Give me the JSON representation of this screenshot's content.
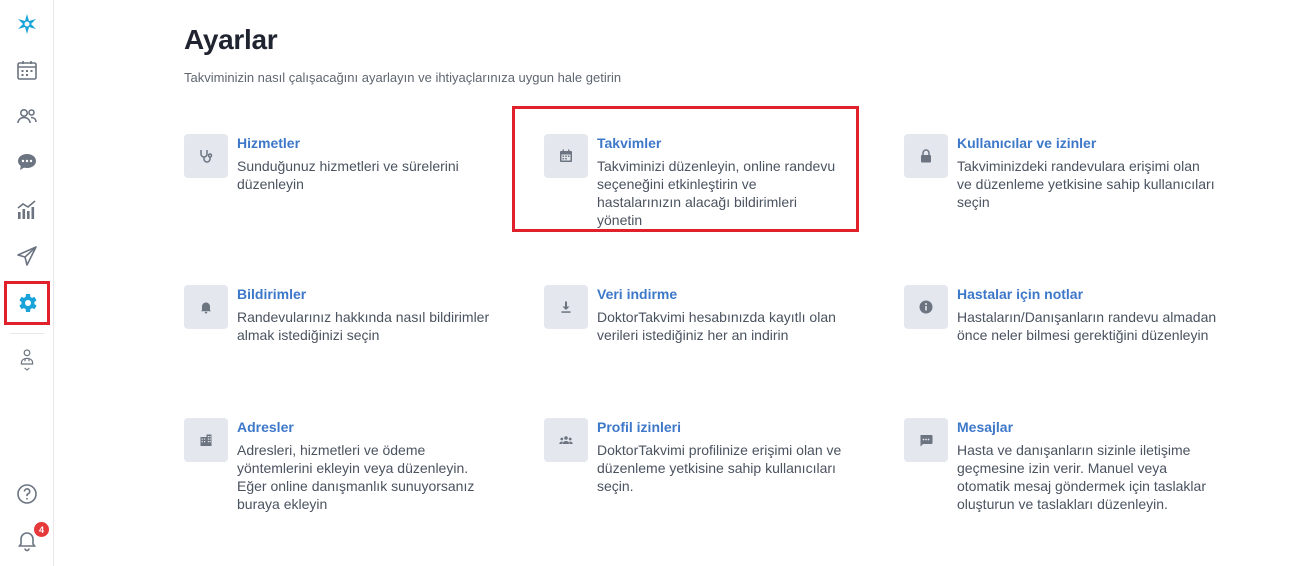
{
  "header": {
    "title": "Ayarlar",
    "subtitle": "Takviminizin nasıl çalışacağını ayarlayın ve ihtiyaçlarınıza uygun hale getirin"
  },
  "sidebar": {
    "items": [
      {
        "name": "logo",
        "icon": "star-logo-icon"
      },
      {
        "name": "calendar",
        "icon": "calendar-icon"
      },
      {
        "name": "patients",
        "icon": "users-icon"
      },
      {
        "name": "messages",
        "icon": "chat-icon"
      },
      {
        "name": "statistics",
        "icon": "chart-icon"
      },
      {
        "name": "campaigns",
        "icon": "send-icon"
      },
      {
        "name": "settings",
        "icon": "gear-icon",
        "active": true
      },
      {
        "name": "doctor-profile",
        "icon": "doctor-icon"
      }
    ],
    "bottom": {
      "help_icon": "help-icon",
      "notifications_icon": "bell-icon",
      "notifications_count": "4"
    }
  },
  "cards": [
    {
      "title": "Hizmetler",
      "desc": "Sunduğunuz hizmetleri ve sürelerini düzenleyin",
      "icon": "stethoscope-icon"
    },
    {
      "title": "Takvimler",
      "desc": "Takviminizi düzenleyin, online randevu seçeneğini etkinleştirin ve hastalarınızın alacağı bildirimleri yönetin",
      "icon": "calendar-icon"
    },
    {
      "title": "Kullanıcılar ve izinler",
      "desc": "Takviminizdeki randevulara erişimi olan ve düzenleme yetkisine sahip kullanıcıları seçin",
      "icon": "lock-icon"
    },
    {
      "title": "Bildirimler",
      "desc": "Randevularınız hakkında nasıl bildirimler almak istediğinizi seçin",
      "icon": "bell-icon"
    },
    {
      "title": "Veri indirme",
      "desc": "DoktorTakvimi hesabınızda kayıtlı olan verileri istediğiniz her an indirin",
      "icon": "download-icon"
    },
    {
      "title": "Hastalar için notlar",
      "desc": "Hastaların/Danışanların randevu almadan önce neler bilmesi gerektiğini düzenleyin",
      "icon": "info-icon"
    },
    {
      "title": "Adresler",
      "desc": "Adresleri, hizmetleri ve ödeme yöntemlerini ekleyin veya düzenleyin. Eğer online danışmanlık sunuyorsanız buraya ekleyin",
      "icon": "building-icon"
    },
    {
      "title": "Profil izinleri",
      "desc": "DoktorTakvimi profilinize erişimi olan ve düzenleme yetkisine sahip kullanıcıları seçin.",
      "icon": "group-icon"
    },
    {
      "title": "Mesajlar",
      "desc": "Hasta ve danışanların sizinle iletişime geçmesine izin verir. Manuel veya otomatik mesaj göndermek için taslaklar oluşturun ve taslakları düzenleyin.",
      "icon": "message-icon"
    }
  ],
  "colors": {
    "accent": "#3d78c9",
    "brand": "#1aa3d9",
    "icon_gray": "#6b7480",
    "highlight": "#e0202b"
  }
}
